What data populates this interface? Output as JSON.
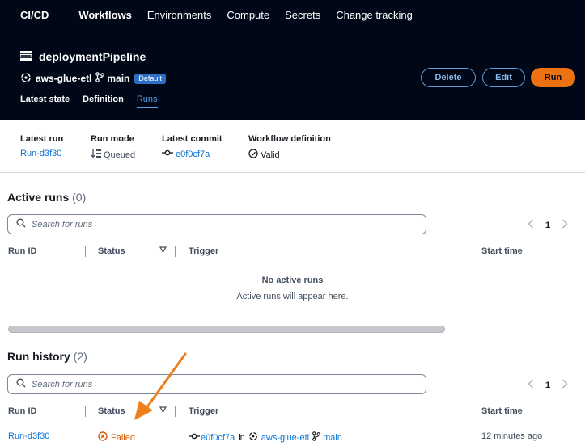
{
  "topnav": {
    "brand": "CI/CD",
    "items": [
      "Workflows",
      "Environments",
      "Compute",
      "Secrets",
      "Change tracking"
    ]
  },
  "workflow": {
    "name": "deploymentPipeline",
    "repo": "aws-glue-etl",
    "branch": "main",
    "default_badge": "Default"
  },
  "tabs": [
    "Latest state",
    "Definition",
    "Runs"
  ],
  "actions": {
    "delete": "Delete",
    "edit": "Edit",
    "run": "Run"
  },
  "summary": {
    "latest_run_label": "Latest run",
    "latest_run_value": "Run-d3f30",
    "run_mode_label": "Run mode",
    "run_mode_value": "Queued",
    "latest_commit_label": "Latest commit",
    "latest_commit_value": "e0f0cf7a",
    "workflow_def_label": "Workflow definition",
    "workflow_def_value": "Valid"
  },
  "active_runs": {
    "title": "Active runs",
    "count": "(0)",
    "search_placeholder": "Search for runs",
    "page": "1",
    "columns": [
      "Run ID",
      "Status",
      "Trigger",
      "Start time"
    ],
    "empty_title": "No active runs",
    "empty_text": "Active runs will appear here."
  },
  "run_history": {
    "title": "Run history",
    "count": "(2)",
    "search_placeholder": "Search for runs",
    "page": "1",
    "columns": [
      "Run ID",
      "Status",
      "Trigger",
      "Start time"
    ],
    "rows": [
      {
        "run_id": "Run-d3f30",
        "status": "Failed",
        "commit": "e0f0cf7a",
        "in": "in",
        "repo": "aws-glue-etl",
        "branch": "main",
        "start_time": "12 minutes ago"
      }
    ]
  },
  "colors": {
    "header_bg": "#000716",
    "accent_link": "#0972d3",
    "primary_button": "#ec7211",
    "failed": "#d45b07",
    "annotation_arrow": "#ef7f1a"
  }
}
